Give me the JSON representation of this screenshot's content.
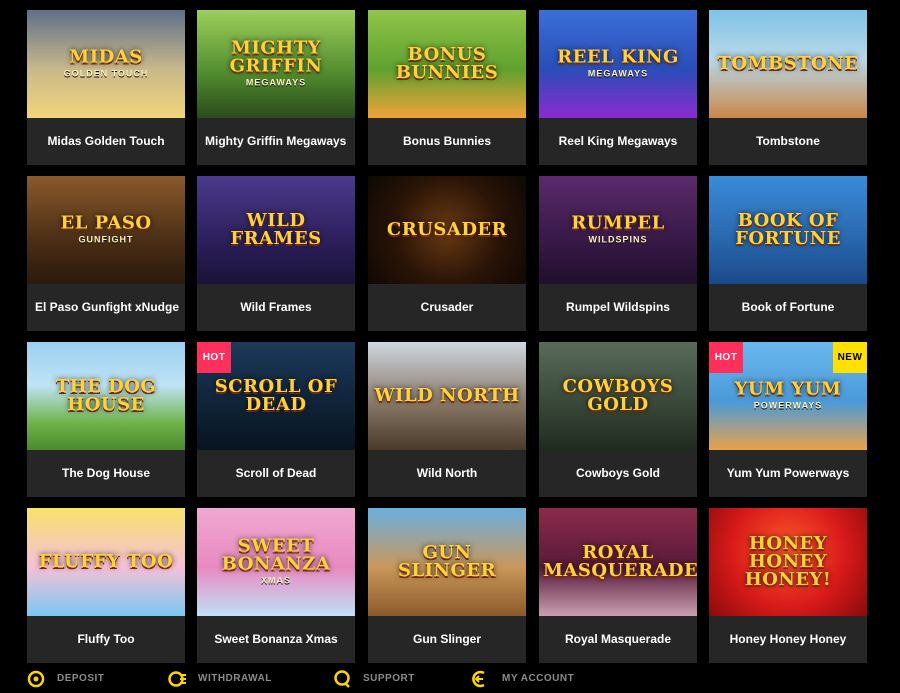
{
  "games": [
    {
      "name": "Midas Golden Touch",
      "art": "MIDAS",
      "art_sub": "GOLDEN TOUCH",
      "bg": "linear-gradient(180deg,#5e6f8a 0%,#c9b98a 55%,#f2d47a 100%)",
      "badges": []
    },
    {
      "name": "Mighty Griffin Megaways",
      "art": "MIGHTY GRIFFIN",
      "art_sub": "MEGAWAYS",
      "bg": "linear-gradient(180deg,#9ccf5a 0%,#4f8a2e 60%,#2c4a1c 100%)",
      "badges": []
    },
    {
      "name": "Bonus Bunnies",
      "art": "BONUS BUNNIES",
      "art_sub": "",
      "bg": "linear-gradient(180deg,#8fc54a 0%,#5fa12e 55%,#f2a23a 100%)",
      "badges": []
    },
    {
      "name": "Reel King Megaways",
      "art": "REEL KING",
      "art_sub": "MEGAWAYS",
      "bg": "linear-gradient(180deg,#3a6fd8 0%,#2a4db8 55%,#8a2ad0 100%)",
      "badges": []
    },
    {
      "name": "Tombstone",
      "art": "TOMBSTONE",
      "art_sub": "",
      "bg": "linear-gradient(180deg,#7ec3e6 0%,#b7d8e8 45%,#c9874a 100%)",
      "badges": []
    },
    {
      "name": "El Paso Gunfight xNudge",
      "art": "EL PASO",
      "art_sub": "GUNFIGHT",
      "bg": "linear-gradient(180deg,#8a5a2a 0%,#4a2e16 60%,#2a1a0c 100%)",
      "badges": []
    },
    {
      "name": "Wild Frames",
      "art": "WILD Frames",
      "art_sub": "",
      "bg": "linear-gradient(180deg,#4a3a8a 0%,#2c1f5c 60%,#1a1236 100%)",
      "badges": []
    },
    {
      "name": "Crusader",
      "art": "CRUSADER",
      "art_sub": "",
      "bg": "radial-gradient(circle at 50% 50%,#6a3a14 0%,#2a1406 55%,#0e0804 100%)",
      "badges": []
    },
    {
      "name": "Rumpel Wildspins",
      "art": "RUMPEL",
      "art_sub": "WILDSPINS",
      "bg": "linear-gradient(180deg,#5a2a6a 0%,#3a1a4a 55%,#1f0f2a 100%)",
      "badges": []
    },
    {
      "name": "Book of Fortune",
      "art": "Book of Fortune",
      "art_sub": "",
      "bg": "linear-gradient(180deg,#3a8ad8 0%,#2a6ab0 55%,#1a4a8a 100%)",
      "badges": []
    },
    {
      "name": "The Dog House",
      "art": "THE DOG HOUSE",
      "art_sub": "",
      "bg": "linear-gradient(180deg,#9ad0f0 0%,#bfe3f5 40%,#6fb34a 75%,#4a8a2e 100%)",
      "badges": []
    },
    {
      "name": "Scroll of Dead",
      "art": "SCROLL OF DEAD",
      "art_sub": "",
      "bg": "linear-gradient(180deg,#1c3a5a 0%,#10243a 55%,#081420 100%)",
      "badges": [
        "HOT"
      ]
    },
    {
      "name": "Wild North",
      "art": "WILD NORTH",
      "art_sub": "",
      "bg": "linear-gradient(180deg,#cfd8e0 0%,#8a7a6a 55%,#4a3a2a 100%)",
      "badges": []
    },
    {
      "name": "Cowboys Gold",
      "art": "COWBOYS GOLD",
      "art_sub": "",
      "bg": "linear-gradient(180deg,#5a6a5a 0%,#3a4a3a 55%,#1f2a1f 100%)",
      "badges": []
    },
    {
      "name": "Yum Yum Powerways",
      "art": "Yum Yum",
      "art_sub": "POWERWAYS",
      "bg": "linear-gradient(180deg,#6ab8f0 0%,#4a9ad8 55%,#e8a24a 100%)",
      "badges": [
        "HOT",
        "NEW"
      ]
    },
    {
      "name": "Fluffy Too",
      "art": "Fluffy Too",
      "art_sub": "",
      "bg": "linear-gradient(180deg,#f8e26a 0%,#f5c0d8 55%,#7ac8f0 100%)",
      "badges": []
    },
    {
      "name": "Sweet Bonanza Xmas",
      "art": "SWEET BONANZA",
      "art_sub": "XMAS",
      "bg": "linear-gradient(180deg,#f0a8d0 0%,#e88ac0 55%,#c0e0f8 100%)",
      "badges": []
    },
    {
      "name": "Gun Slinger",
      "art": "GUN SLINGER",
      "art_sub": "",
      "bg": "linear-gradient(180deg,#6ab0e0 0%,#c9975a 55%,#8a5a2a 100%)",
      "badges": []
    },
    {
      "name": "Royal Masquerade",
      "art": "Royal Masquerade",
      "art_sub": "",
      "bg": "linear-gradient(180deg,#8a2a4a 0%,#5a1a3a 55%,#c9a0b0 100%)",
      "badges": []
    },
    {
      "name": "Honey Honey Honey",
      "art": "HONEY HONEY HONEY!",
      "art_sub": "",
      "bg": "radial-gradient(circle at 50% 40%,#ff5a2a 0%,#d81a1a 55%,#8a0a0a 100%)",
      "badges": []
    }
  ],
  "footer": [
    {
      "label": "DEPOSIT",
      "icon": "deposit-icon"
    },
    {
      "label": "WITHDRAWAL",
      "icon": "withdrawal-icon"
    },
    {
      "label": "SUPPORT",
      "icon": "support-icon"
    },
    {
      "label": "MY ACCOUNT",
      "icon": "account-icon"
    }
  ],
  "colors": {
    "hot_badge": "#ff2f5b",
    "new_badge": "#ffe000",
    "footer_icon": "#ffd400",
    "card_bg": "#262626"
  }
}
